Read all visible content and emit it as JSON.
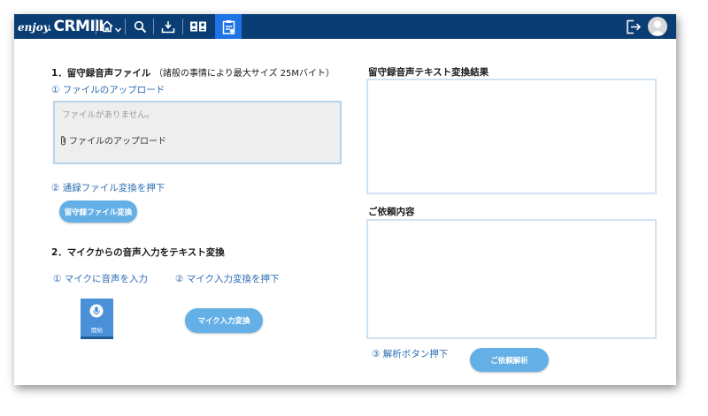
{
  "app": {
    "logo_prefix": "enjoy.",
    "logo_main": "CRMⅢ"
  },
  "nav": {
    "icons": [
      "home-icon",
      "chevron-down-icon",
      "search-icon",
      "download-icon",
      "contacts-icon",
      "clipboard-icon"
    ],
    "active": "clipboard-icon",
    "right_icons": [
      "logout-icon",
      "avatar"
    ]
  },
  "section1": {
    "title": "1．留守録音声ファイル",
    "note": "（諸般の事情により最大サイズ 25Mバイト）",
    "step1": "① ファイルのアップロード",
    "upload": {
      "empty_text": "ファイルがありません。",
      "upload_link": "ファイルのアップロード"
    },
    "step2": "② 通録ファイル変換を押下",
    "convert_button": "留守録ファイル変換"
  },
  "section2": {
    "title": "2．マイクからの音声入力をテキスト変換",
    "step1": "① マイクに音声を入力",
    "step2": "② マイク入力変換を押下",
    "mic_label": "開始",
    "convert_button": "マイク入力変換"
  },
  "right": {
    "result_title": "留守録音声テキスト変換結果",
    "request_title": "ご依頼内容",
    "step3": "③ 解析ボタン押下",
    "analyze_button": "ご依頼解析"
  },
  "colors": {
    "topbar": "#0a3d73",
    "active_tab": "#1e73e6",
    "button": "#64b0e6",
    "link": "#2b6cb0"
  }
}
